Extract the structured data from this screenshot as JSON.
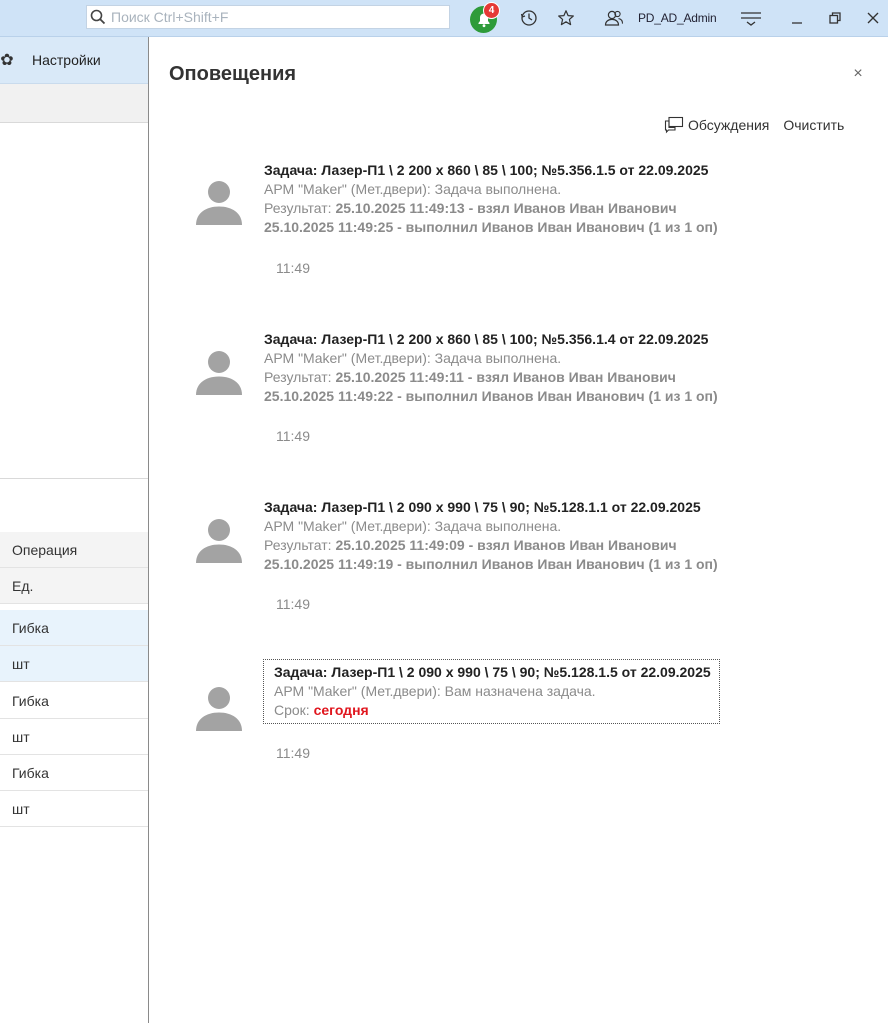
{
  "topbar": {
    "search_placeholder": "Поиск Ctrl+Shift+F",
    "notifications_count": "4",
    "user_name": "PD_AD_Admin",
    "icons": [
      "search-icon",
      "bell-icon",
      "history-icon",
      "star-icon",
      "user-icon",
      "menu-icon",
      "minimize-icon",
      "restore-icon",
      "close-icon"
    ]
  },
  "left": {
    "settings_label": "Настройки",
    "table": {
      "headers": [
        "Операция",
        "Ед."
      ],
      "rows": [
        {
          "op": "Гибка",
          "unit": "шт"
        },
        {
          "op": "Гибка",
          "unit": "шт"
        },
        {
          "op": "Гибка",
          "unit": "шт"
        }
      ]
    }
  },
  "panel": {
    "title": "Оповещения",
    "close_label": "×",
    "discussions_label": "Обсуждения",
    "clear_label": "Очистить",
    "notifications": [
      {
        "title": "Задача: Лазер-П1 \\ 2 200 x 860 \\ 85 \\ 100; №5.356.1.5 от 22.09.2025",
        "line1": "АРМ \"Maker\" (Мет.двери): Задача выполнена.",
        "result_label": "Результат: ",
        "result_value": "25.10.2025 11:49:13 - взял Иванов Иван Иванович",
        "line3": "25.10.2025 11:49:25 - выполнил Иванов Иван Иванович (1 из 1 оп)",
        "time": "11:49"
      },
      {
        "title": "Задача: Лазер-П1 \\ 2 200 x 860 \\ 85 \\ 100; №5.356.1.4 от 22.09.2025",
        "line1": "АРМ \"Maker\" (Мет.двери): Задача выполнена.",
        "result_label": "Результат: ",
        "result_value": "25.10.2025 11:49:11 - взял Иванов Иван Иванович",
        "line3": "25.10.2025 11:49:22 - выполнил Иванов Иван Иванович (1 из 1 оп)",
        "time": "11:49"
      },
      {
        "title": "Задача: Лазер-П1 \\ 2 090 x 990 \\ 75 \\ 90; №5.128.1.1 от 22.09.2025",
        "line1": "АРМ \"Maker\" (Мет.двери): Задача выполнена.",
        "result_label": "Результат: ",
        "result_value": "25.10.2025 11:49:09 - взял Иванов Иван Иванович",
        "line3": "25.10.2025 11:49:19 - выполнил Иванов Иван Иванович (1 из 1 оп)",
        "time": "11:49"
      },
      {
        "title": "Задача: Лазер-П1 \\ 2 090 x 990 \\ 75 \\ 90; №5.128.1.5 от 22.09.2025",
        "line1": "АРМ \"Maker\" (Мет.двери): Вам назначена задача.",
        "due_label": "Срок: ",
        "due_value": "сегодня",
        "time": "11:49"
      }
    ]
  },
  "colors": {
    "topbar_bg": "#cfe3f7",
    "bell_green": "#2e9b3a",
    "badge_red": "#e53935",
    "due_red": "#e0161e",
    "muted_text": "#8b8b8b"
  }
}
